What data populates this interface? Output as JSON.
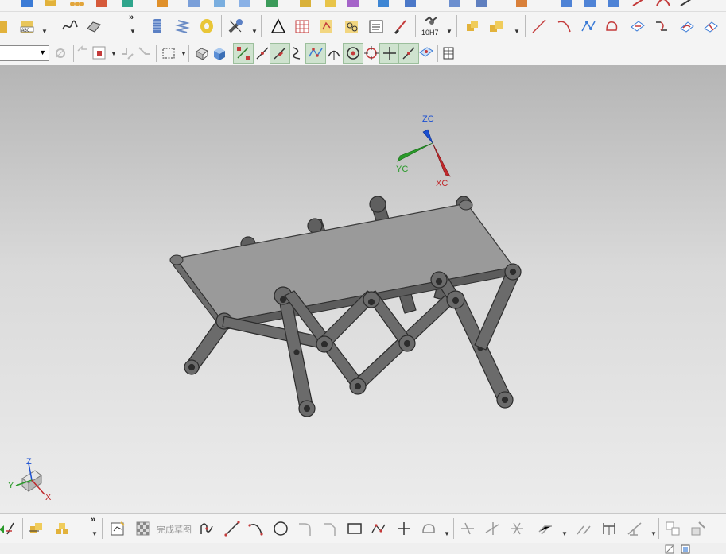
{
  "toolbar2": {
    "tolerance_label": "10H7"
  },
  "toolbar3": {
    "selection_filter_value": ""
  },
  "sketch_toolbar": {
    "finish_sketch_label": "完成草图"
  },
  "wcs": {
    "zc": "ZC",
    "yc": "YC",
    "xc": "XC"
  },
  "triad": {
    "z": "Z",
    "y": "Y",
    "x": "X"
  },
  "colors": {
    "axis_z": "#1a4fd1",
    "axis_y": "#2a9a2a",
    "axis_x": "#c0282b",
    "part_fill": "#6b6b6b"
  }
}
